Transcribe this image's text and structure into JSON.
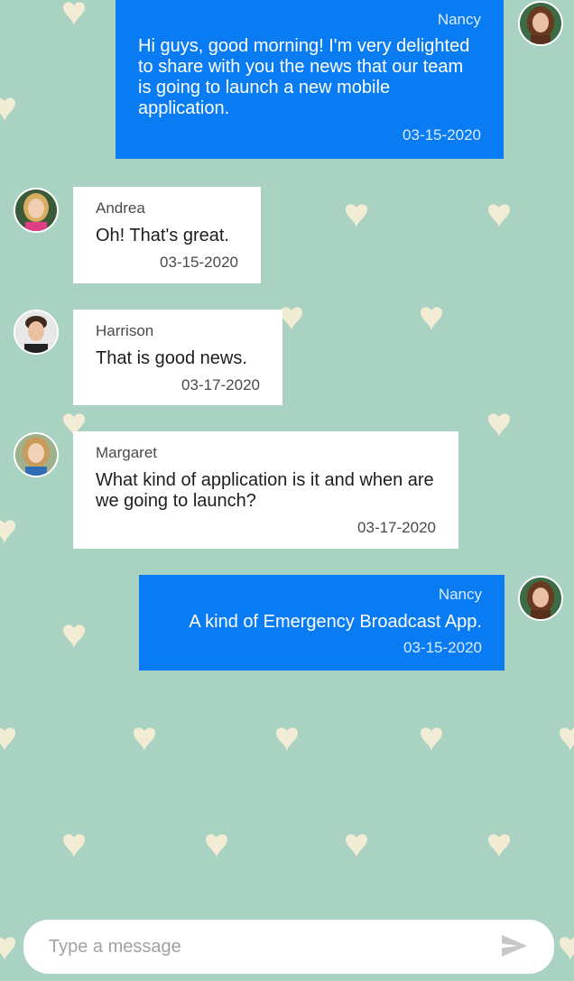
{
  "messages": [
    {
      "sender": "Nancy",
      "text": "Hi guys, good morning! I'm very delighted to share with you the news that our team is going to launch a new mobile application.",
      "date": "03-15-2020",
      "direction": "outgoing"
    },
    {
      "sender": "Andrea",
      "text": "Oh! That's great.",
      "date": "03-15-2020",
      "direction": "incoming"
    },
    {
      "sender": "Harrison",
      "text": "That is good news.",
      "date": "03-17-2020",
      "direction": "incoming"
    },
    {
      "sender": "Margaret",
      "text": "What kind of application is it and when are we going to launch?",
      "date": "03-17-2020",
      "direction": "incoming"
    },
    {
      "sender": "Nancy",
      "text": "A kind of Emergency Broadcast App.",
      "date": "03-15-2020",
      "direction": "outgoing"
    }
  ],
  "composer": {
    "placeholder": "Type a message",
    "send_icon": "send-icon"
  },
  "colors": {
    "background": "#a9d2c2",
    "outgoing_bubble": "#0a7cf3",
    "incoming_bubble": "#ffffff",
    "heart": "#f3ecd4"
  }
}
